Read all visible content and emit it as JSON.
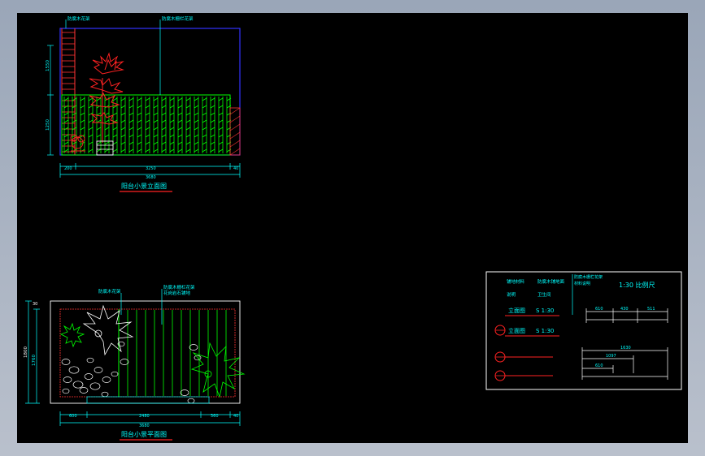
{
  "elevation": {
    "title": "阳台小景立面图",
    "label_top_left": "防腐木花架",
    "label_top_right": "防腐木栅栏花架",
    "dims_bottom": [
      "200",
      "3250",
      "40"
    ],
    "dim_total": "3680",
    "dims_left": [
      "1550",
      "1250"
    ]
  },
  "plan": {
    "title": "阳台小景平面图",
    "label_top_left": "防腐木花架",
    "label_top_right_1": "防腐木栅栏花架",
    "label_top_right_2": "花岗岩石铺地",
    "dims_bottom": [
      "600",
      "2480",
      "560",
      "40"
    ],
    "dim_total": "3680",
    "dims_left": [
      "1800",
      "1760"
    ],
    "dim_small": "30"
  },
  "legend": {
    "row1_a": "铺地材料",
    "row1_b": "防腐木铺地面",
    "row2_a": "说明",
    "row2_b": "卫生间",
    "note": "防腐木栅栏花架",
    "note2": "材料说明",
    "scale_title": "1:30 比例尺",
    "elev_label": "立面图",
    "elev_scale": "S 1:30",
    "sec_label": "立面图",
    "sec_scale": "S 1:30",
    "dims_a": [
      "610",
      "430",
      "511"
    ],
    "dim_b_total": "1630",
    "dim_b_mid": "1097",
    "dim_b_small": "610"
  },
  "colors": {
    "cyan": "#00ffff",
    "green": "#00ff00",
    "red": "#ff0000",
    "blue": "#0000ff",
    "white": "#ffffff"
  }
}
